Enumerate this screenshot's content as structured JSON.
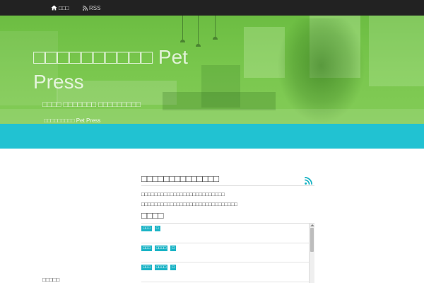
{
  "colors": {
    "topbar": "#222222",
    "accent_band": "#21c2d2",
    "tag": "#1db4c6",
    "hero_green": "#78c64c"
  },
  "topnav": {
    "items": [
      {
        "icon": "home-icon",
        "label": "□□□"
      },
      {
        "icon": "rss-icon",
        "label": "RSS"
      }
    ]
  },
  "hero": {
    "title": "□□□□□□□□□□ Pet Press",
    "subtitle": "□□□□ □□□□□□□ □□□□□□□□□",
    "breadcrumb": "□□□□□□□□□ Pet Press"
  },
  "main": {
    "heading": "□□□□□□□□□□□□□□",
    "feed_icon": "rss-icon",
    "description": [
      "□□□□□□□□□□□□□□□□□□□□□□□□□□",
      "□□□□□□□□□□□□□□□□□□□□□□□□□□□□□□"
    ],
    "list_heading": "□□□□",
    "list_items": [
      {
        "tags": [
          "□□□",
          "□"
        ]
      },
      {
        "tags": [
          "□□□",
          "□□□□",
          "□"
        ]
      },
      {
        "tags": [
          "□□□",
          "□□□□",
          "□"
        ]
      }
    ]
  },
  "sidebar": {
    "heading": "□□□□□"
  }
}
